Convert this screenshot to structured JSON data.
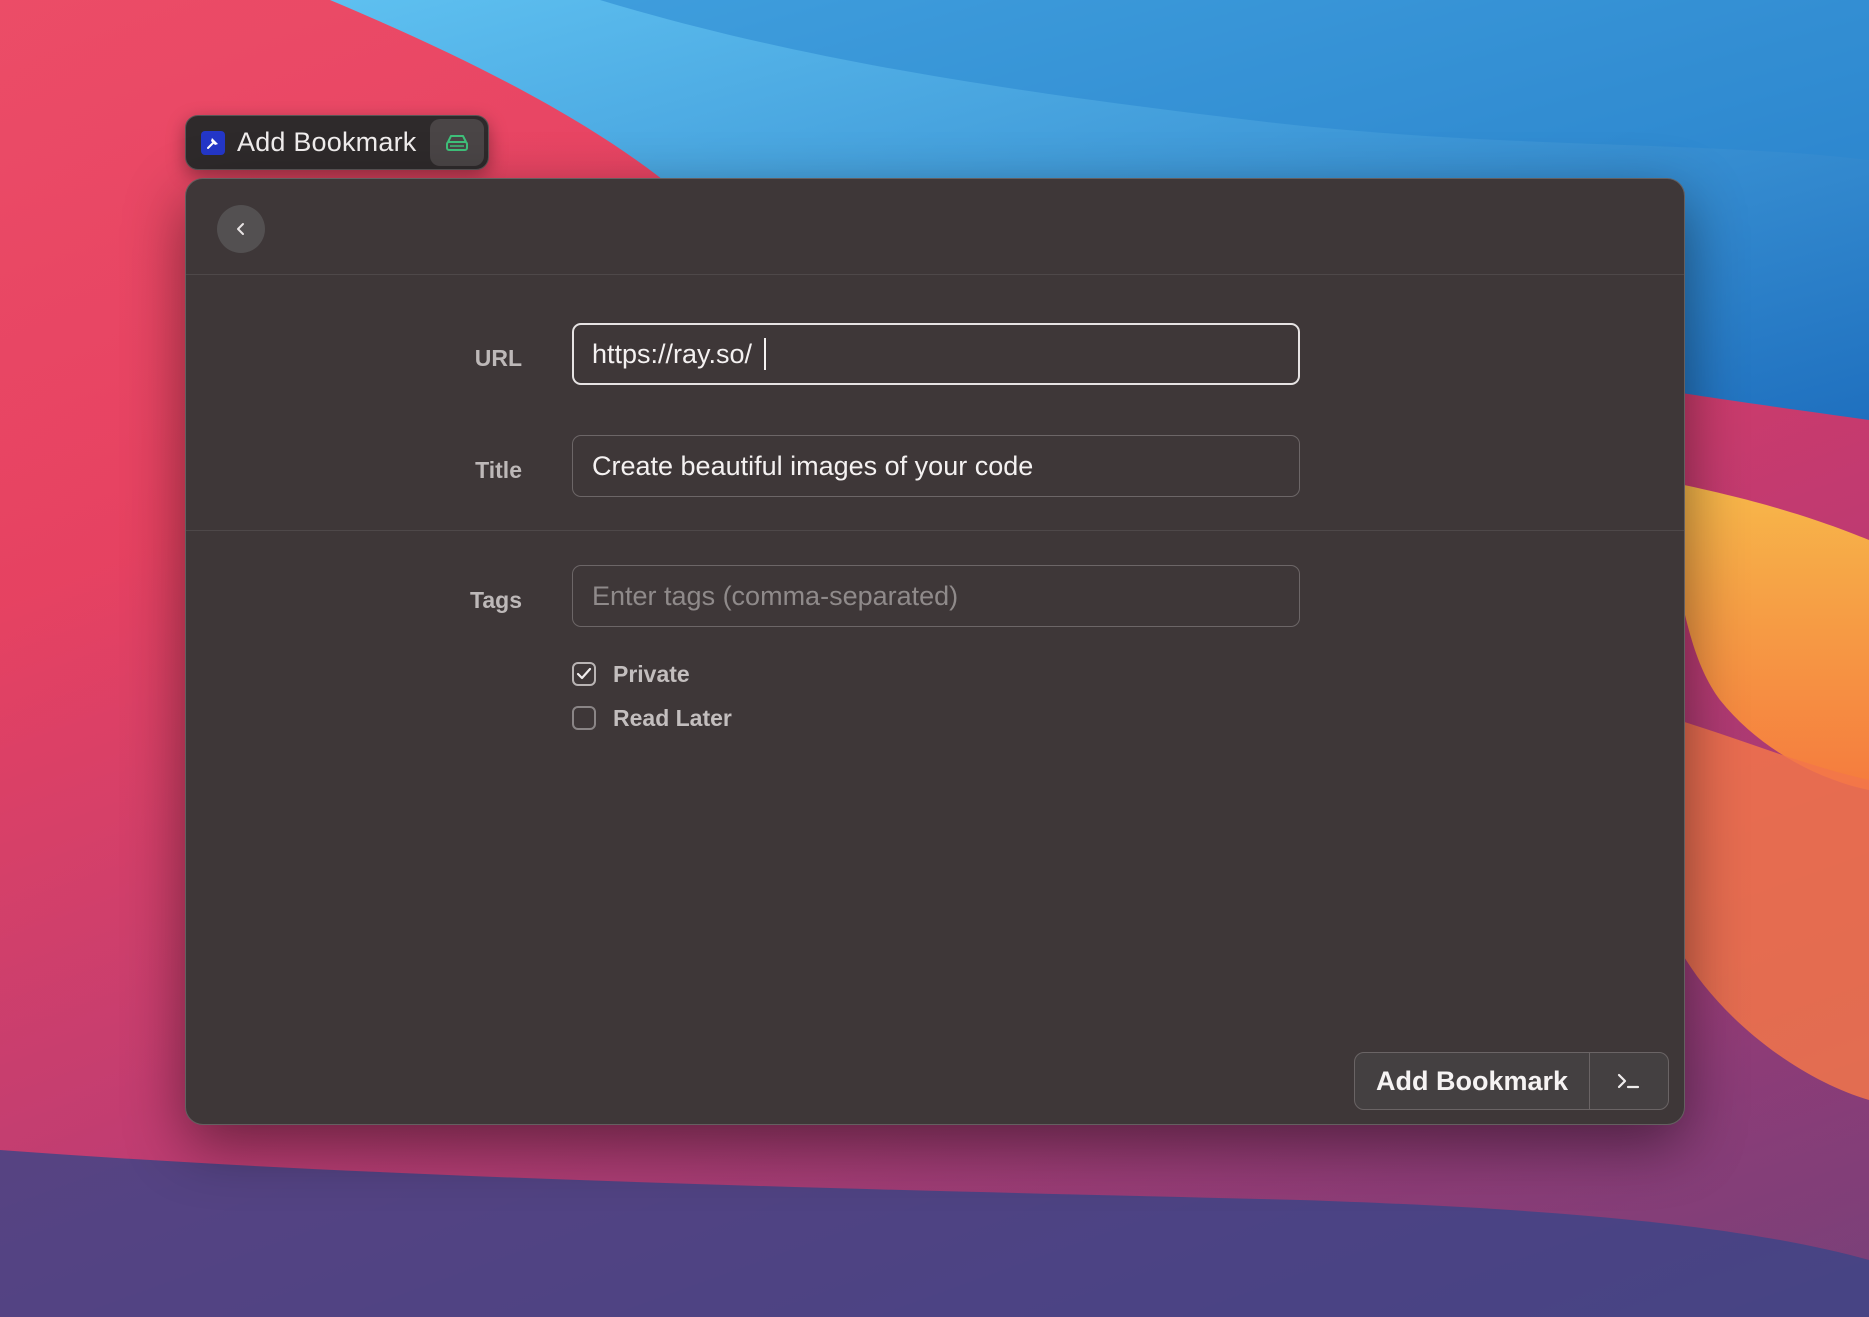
{
  "tab": {
    "title": "Add Bookmark",
    "app_icon": "pin-icon",
    "extension_icon": "drive-icon"
  },
  "header": {
    "back_icon": "chevron-left-icon"
  },
  "form": {
    "url_label": "URL",
    "url_value": "https://ray.so/",
    "title_label": "Title",
    "title_value": "Create beautiful images of your code",
    "tags_label": "Tags",
    "tags_value": "",
    "tags_placeholder": "Enter tags (comma-separated)",
    "private_label": "Private",
    "private_checked": true,
    "read_later_label": "Read Later",
    "read_later_checked": false
  },
  "actions": {
    "primary_label": "Add Bookmark",
    "menu_icon": "terminal-icon"
  },
  "colors": {
    "window_bg": "#3e3738",
    "accent_app_icon": "#2437c8",
    "extension_icon": "#3fc07a"
  }
}
